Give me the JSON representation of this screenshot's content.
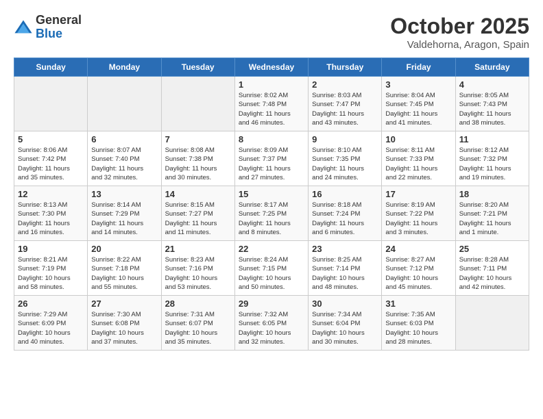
{
  "header": {
    "logo_general": "General",
    "logo_blue": "Blue",
    "month_title": "October 2025",
    "location": "Valdehorna, Aragon, Spain"
  },
  "days_of_week": [
    "Sunday",
    "Monday",
    "Tuesday",
    "Wednesday",
    "Thursday",
    "Friday",
    "Saturday"
  ],
  "weeks": [
    [
      {
        "day": "",
        "info": ""
      },
      {
        "day": "",
        "info": ""
      },
      {
        "day": "",
        "info": ""
      },
      {
        "day": "1",
        "info": "Sunrise: 8:02 AM\nSunset: 7:48 PM\nDaylight: 11 hours\nand 46 minutes."
      },
      {
        "day": "2",
        "info": "Sunrise: 8:03 AM\nSunset: 7:47 PM\nDaylight: 11 hours\nand 43 minutes."
      },
      {
        "day": "3",
        "info": "Sunrise: 8:04 AM\nSunset: 7:45 PM\nDaylight: 11 hours\nand 41 minutes."
      },
      {
        "day": "4",
        "info": "Sunrise: 8:05 AM\nSunset: 7:43 PM\nDaylight: 11 hours\nand 38 minutes."
      }
    ],
    [
      {
        "day": "5",
        "info": "Sunrise: 8:06 AM\nSunset: 7:42 PM\nDaylight: 11 hours\nand 35 minutes."
      },
      {
        "day": "6",
        "info": "Sunrise: 8:07 AM\nSunset: 7:40 PM\nDaylight: 11 hours\nand 32 minutes."
      },
      {
        "day": "7",
        "info": "Sunrise: 8:08 AM\nSunset: 7:38 PM\nDaylight: 11 hours\nand 30 minutes."
      },
      {
        "day": "8",
        "info": "Sunrise: 8:09 AM\nSunset: 7:37 PM\nDaylight: 11 hours\nand 27 minutes."
      },
      {
        "day": "9",
        "info": "Sunrise: 8:10 AM\nSunset: 7:35 PM\nDaylight: 11 hours\nand 24 minutes."
      },
      {
        "day": "10",
        "info": "Sunrise: 8:11 AM\nSunset: 7:33 PM\nDaylight: 11 hours\nand 22 minutes."
      },
      {
        "day": "11",
        "info": "Sunrise: 8:12 AM\nSunset: 7:32 PM\nDaylight: 11 hours\nand 19 minutes."
      }
    ],
    [
      {
        "day": "12",
        "info": "Sunrise: 8:13 AM\nSunset: 7:30 PM\nDaylight: 11 hours\nand 16 minutes."
      },
      {
        "day": "13",
        "info": "Sunrise: 8:14 AM\nSunset: 7:29 PM\nDaylight: 11 hours\nand 14 minutes."
      },
      {
        "day": "14",
        "info": "Sunrise: 8:15 AM\nSunset: 7:27 PM\nDaylight: 11 hours\nand 11 minutes."
      },
      {
        "day": "15",
        "info": "Sunrise: 8:17 AM\nSunset: 7:25 PM\nDaylight: 11 hours\nand 8 minutes."
      },
      {
        "day": "16",
        "info": "Sunrise: 8:18 AM\nSunset: 7:24 PM\nDaylight: 11 hours\nand 6 minutes."
      },
      {
        "day": "17",
        "info": "Sunrise: 8:19 AM\nSunset: 7:22 PM\nDaylight: 11 hours\nand 3 minutes."
      },
      {
        "day": "18",
        "info": "Sunrise: 8:20 AM\nSunset: 7:21 PM\nDaylight: 11 hours\nand 1 minute."
      }
    ],
    [
      {
        "day": "19",
        "info": "Sunrise: 8:21 AM\nSunset: 7:19 PM\nDaylight: 10 hours\nand 58 minutes."
      },
      {
        "day": "20",
        "info": "Sunrise: 8:22 AM\nSunset: 7:18 PM\nDaylight: 10 hours\nand 55 minutes."
      },
      {
        "day": "21",
        "info": "Sunrise: 8:23 AM\nSunset: 7:16 PM\nDaylight: 10 hours\nand 53 minutes."
      },
      {
        "day": "22",
        "info": "Sunrise: 8:24 AM\nSunset: 7:15 PM\nDaylight: 10 hours\nand 50 minutes."
      },
      {
        "day": "23",
        "info": "Sunrise: 8:25 AM\nSunset: 7:14 PM\nDaylight: 10 hours\nand 48 minutes."
      },
      {
        "day": "24",
        "info": "Sunrise: 8:27 AM\nSunset: 7:12 PM\nDaylight: 10 hours\nand 45 minutes."
      },
      {
        "day": "25",
        "info": "Sunrise: 8:28 AM\nSunset: 7:11 PM\nDaylight: 10 hours\nand 42 minutes."
      }
    ],
    [
      {
        "day": "26",
        "info": "Sunrise: 7:29 AM\nSunset: 6:09 PM\nDaylight: 10 hours\nand 40 minutes."
      },
      {
        "day": "27",
        "info": "Sunrise: 7:30 AM\nSunset: 6:08 PM\nDaylight: 10 hours\nand 37 minutes."
      },
      {
        "day": "28",
        "info": "Sunrise: 7:31 AM\nSunset: 6:07 PM\nDaylight: 10 hours\nand 35 minutes."
      },
      {
        "day": "29",
        "info": "Sunrise: 7:32 AM\nSunset: 6:05 PM\nDaylight: 10 hours\nand 32 minutes."
      },
      {
        "day": "30",
        "info": "Sunrise: 7:34 AM\nSunset: 6:04 PM\nDaylight: 10 hours\nand 30 minutes."
      },
      {
        "day": "31",
        "info": "Sunrise: 7:35 AM\nSunset: 6:03 PM\nDaylight: 10 hours\nand 28 minutes."
      },
      {
        "day": "",
        "info": ""
      }
    ]
  ]
}
